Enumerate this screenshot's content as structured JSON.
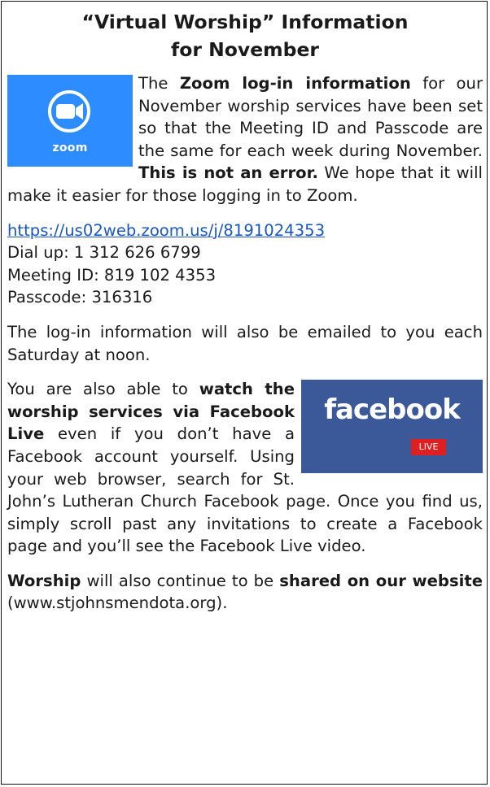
{
  "title": {
    "line1": "“Virtual Worship” Information",
    "line2": "for November"
  },
  "zoom_logo": {
    "text": "zoom",
    "color": "#2d8cff"
  },
  "zoom_paragraph": {
    "intro": "The ",
    "bold1": "Zoom log-in information",
    "middle": " for our November worship services have been set so that the Meeting ID and Passcode are the same for each week during November. ",
    "bold2": "This is not an error.",
    "end": " We hope that it will make it easier for those logging in to Zoom."
  },
  "zoom_details": {
    "link": "https://us02web.zoom.us/j/8191024353",
    "dial_up": "Dial up: 1 312 626 6799",
    "meeting_id": "Meeting ID: 819 102 4353",
    "passcode": "Passcode: 316316"
  },
  "email_note": "The log-in information will also be emailed to you each Saturday at noon.",
  "facebook_logo": {
    "text": "facebook",
    "badge": "LIVE",
    "color": "#3b5998",
    "badge_color": "#e02020"
  },
  "facebook_paragraph": {
    "intro": "You are also able to ",
    "bold": "watch the worship services via Facebook Live",
    "end": " even if you don’t have a Facebook account yourself.  Using your web browser, search for St. John’s Lutheran Church Facebook page. Once you find us, simply scroll past any invitations to create a Facebook page and you’ll see the Facebook Live video."
  },
  "website_paragraph": {
    "bold1": "Worship",
    "middle": " will also continue to be ",
    "bold2": "shared on our website",
    "end": " (www.stjohnsmendota.org)."
  }
}
